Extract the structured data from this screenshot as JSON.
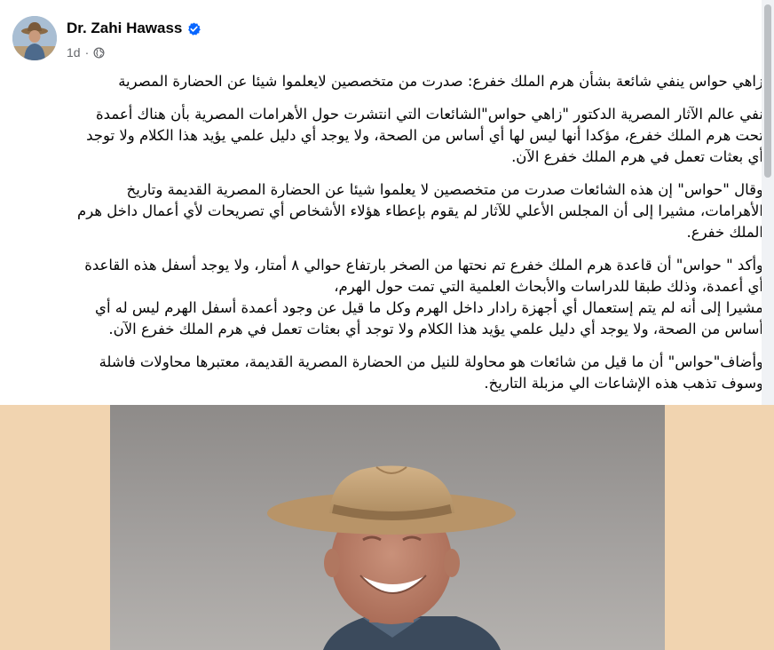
{
  "author": {
    "name": "Dr. Zahi Hawass",
    "verified": true,
    "timestamp": "1d",
    "separator": "·",
    "audience_icon": "globe-icon"
  },
  "post": {
    "paragraphs": [
      {
        "lines": [
          "زاهي حواس ينفي شائعة بشأن هرم الملك خفرع: صدرت من متخصصين لايعلموا شيئا عن الحضارة المصرية"
        ]
      },
      {
        "lines": [
          "نفي عالم الآثار المصرية الدكتور \"زاهي حواس\"الشائعات التي انتشرت  حول الأهرامات المصرية بأن هناك أعمدة",
          "تحت هرم الملك خفرع، مؤكدا أنها ليس لها أي أساس من الصحة، ولا يوجد أي دليل علمي يؤيد هذا الكلام ولا توجد",
          "أي بعثات تعمل في هرم الملك خفرع الآن."
        ]
      },
      {
        "lines": [
          "وقال  \"حواس\" إن هذه الشائعات صدرت من متخصصين لا يعلموا شيئا عن الحضارة المصرية القديمة وتاريخ",
          "الأهرامات، مشيرا إلى أن المجلس الأعلي للآثار لم يقوم بإعطاء هؤلاء الأشخاص أي تصريحات لأي أعمال داخل هرم",
          "الملك خفرع."
        ]
      },
      {
        "lines": [
          "وأكد \" حواس\" أن قاعدة هرم الملك خفرع تم نحتها من الصخر بارتفاع حوالي ٨ أمتار، ولا يوجد أسفل هذه القاعدة",
          "أي أعمدة، وذلك طبقا للدراسات والأبحاث العلمية التي تمت حول الهرم،",
          "مشيرا إلى أنه لم يتم إستعمال أي أجهزة رادار داخل الهرم وكل ما قيل عن وجود أعمدة أسفل الهرم ليس له أي",
          "أساس من الصحة، ولا يوجد أي دليل علمي يؤيد هذا الكلام ولا توجد أي بعثات تعمل في هرم الملك خفرع الآن."
        ]
      },
      {
        "lines": [
          "وأضاف\"حواس\" أن ما قيل من شائعات هو محاولة للنيل من الحضارة المصرية القديمة، معتبرها محاولات فاشلة",
          "وسوف تذهب هذه الإشاعات الي مزبلة التاريخ."
        ]
      }
    ]
  },
  "colors": {
    "verified_badge": "#0866ff",
    "meta_text": "#65676b",
    "photo_backdrop": "#f1d4b0"
  },
  "icons": [
    "verified-badge-icon",
    "globe-icon"
  ]
}
